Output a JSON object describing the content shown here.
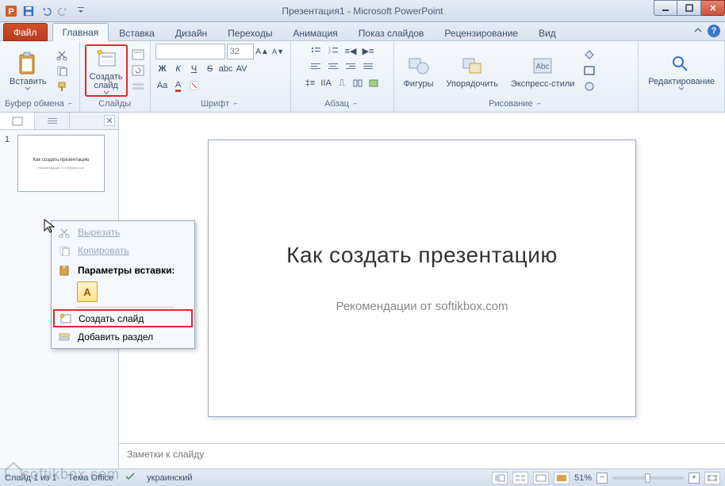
{
  "window": {
    "title": "Презентация1 - Microsoft PowerPoint"
  },
  "tabs": {
    "file": "Файл",
    "home": "Главная",
    "insert": "Вставка",
    "design": "Дизайн",
    "transitions": "Переходы",
    "animation": "Анимация",
    "slideshow": "Показ слайдов",
    "review": "Рецензирование",
    "view": "Вид"
  },
  "ribbon": {
    "clipboard": {
      "label": "Буфер обмена",
      "paste": "Вставить"
    },
    "slides": {
      "label": "Слайды",
      "new_slide": "Создать\nслайд"
    },
    "font": {
      "label": "Шрифт",
      "size": "32"
    },
    "paragraph": {
      "label": "Абзац"
    },
    "drawing": {
      "label": "Рисование",
      "shapes": "Фигуры",
      "arrange": "Упорядочить",
      "quick_styles": "Экспресс-стили"
    },
    "editing": {
      "label": "Редактирование"
    }
  },
  "slides_panel": {
    "slide_num": "1",
    "thumb_title": "Как создать презентацию",
    "thumb_sub": "Рекомендации от softikbox.com"
  },
  "slide": {
    "title": "Как создать презентацию",
    "subtitle": "Рекомендации от softikbox.com"
  },
  "notes": {
    "placeholder": "Заметки к слайду"
  },
  "context_menu": {
    "cut": "Вырезать",
    "copy": "Копировать",
    "paste_header": "Параметры вставки:",
    "new_slide": "Создать слайд",
    "add_section": "Добавить раздел"
  },
  "statusbar": {
    "left1": "Слайд 1 из 1",
    "left2": "Тема Office",
    "lang": "украинский",
    "zoom": "51%"
  },
  "watermark": "softikbox.com"
}
